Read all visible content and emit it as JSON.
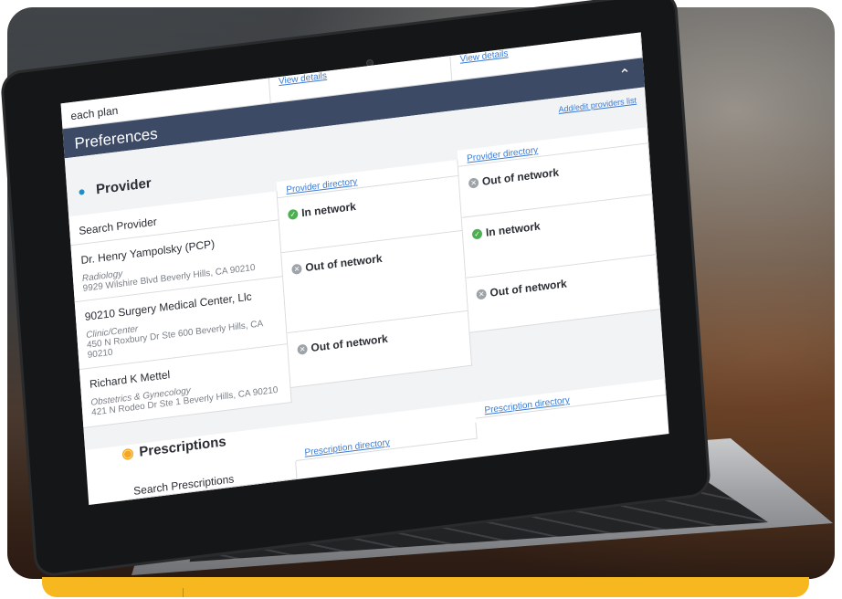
{
  "top_strip": {
    "label": "each plan",
    "col2_link": "View details",
    "col3_link": "View details"
  },
  "preferences": {
    "title": "Preferences",
    "collapse_icon": "chevron-up-icon"
  },
  "add_edit_link": "Add/edit providers list",
  "provider": {
    "title": "Provider",
    "icon": "user-icon",
    "search_label": "Search Provider",
    "directory_links": [
      "Provider directory",
      "Provider directory"
    ],
    "rows": [
      {
        "name": "Dr. Henry Yampolsky (PCP)",
        "specialty": "Radiology",
        "address": "9929 Wilshire Blvd Beverly Hills, CA 90210",
        "plan1": "In network",
        "plan2": "Out of network"
      },
      {
        "name": "90210 Surgery Medical Center, Llc",
        "specialty": "Clinic/Center",
        "address": "450 N Roxbury Dr Ste 600 Beverly Hills, CA 90210",
        "plan1": "Out of network",
        "plan2": "In network"
      },
      {
        "name": "Richard K Mettel",
        "specialty": "Obstetrics & Gynecology",
        "address": "421 N Rodeo Dr Ste 1 Beverly Hills, CA 90210",
        "plan1": "Out of network",
        "plan2": "Out of network"
      }
    ]
  },
  "prescriptions": {
    "title": "Prescriptions",
    "icon": "pills-icon",
    "search_label": "Search Prescriptions",
    "directory_links": [
      "Prescription directory",
      "Prescription directory"
    ]
  },
  "colors": {
    "header_bar": "#3c4a66",
    "link": "#3a7bd5",
    "in_network": "#4caf50",
    "out_network": "#9ea3a9",
    "accent_yellow": "#f6b71f"
  }
}
